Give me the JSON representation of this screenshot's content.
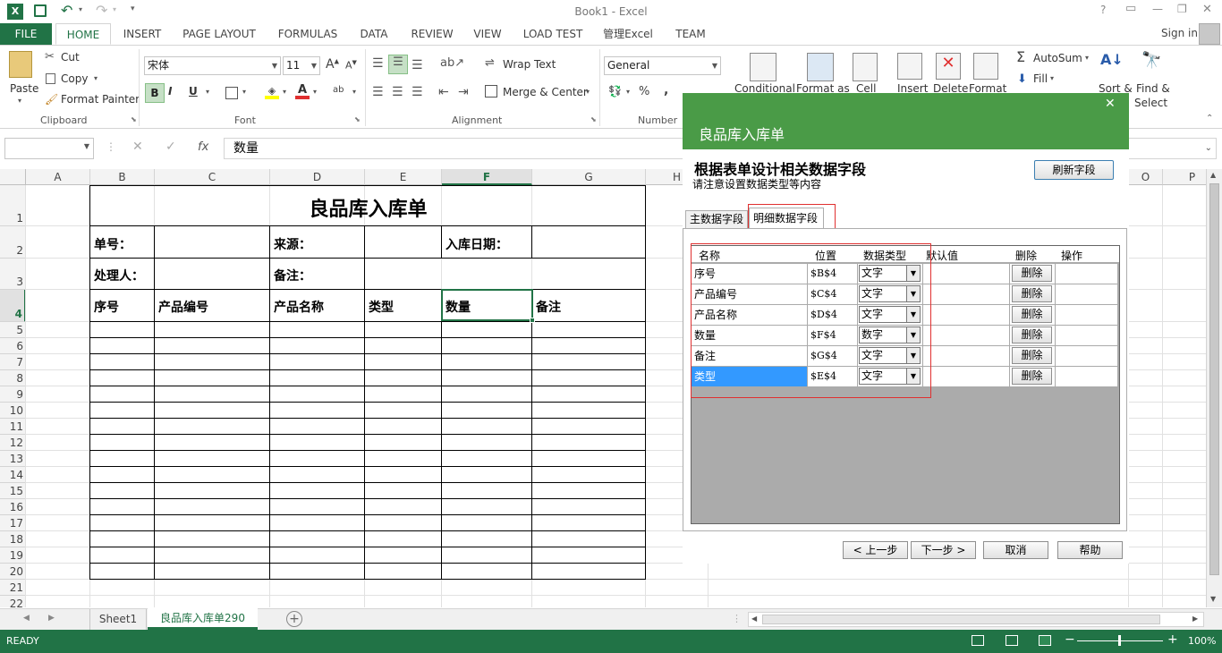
{
  "window": {
    "title": "Book1 - Excel",
    "help": "?",
    "restore_ribbon": "▭",
    "minimize": "—",
    "maximize": "❐",
    "close": "✕"
  },
  "ribbon_tabs": [
    "FILE",
    "HOME",
    "INSERT",
    "PAGE LAYOUT",
    "FORMULAS",
    "DATA",
    "REVIEW",
    "VIEW",
    "LOAD TEST",
    "管理Excel",
    "TEAM"
  ],
  "user": {
    "sign_in": "Sign in"
  },
  "clipboard": {
    "paste": "Paste",
    "cut": "Cut",
    "copy": "Copy",
    "format_painter": "Format Painter",
    "label": "Clipboard"
  },
  "font": {
    "name": "宋体",
    "size": "11",
    "bold": "B",
    "italic": "I",
    "underline": "U",
    "label": "Font"
  },
  "alignment": {
    "wrap_text": "Wrap Text",
    "merge_center": "Merge & Center",
    "label": "Alignment"
  },
  "number": {
    "format": "General",
    "label": "Number"
  },
  "styles": {
    "conditional": "Conditional",
    "format_as": "Format as",
    "cell": "Cell"
  },
  "cells": {
    "insert": "Insert",
    "delete": "Delete",
    "format": "Format"
  },
  "editing": {
    "autosum": "AutoSum",
    "fill": "Fill",
    "sort": "Sort &",
    "find": "Find &",
    "select": "Select"
  },
  "formula_bar": {
    "name_box": "",
    "fx": "fx",
    "value": "数量"
  },
  "columns": [
    "A",
    "B",
    "C",
    "D",
    "E",
    "F",
    "G",
    "H",
    "P"
  ],
  "rows": [
    "1",
    "2",
    "3",
    "4",
    "5",
    "6",
    "7",
    "8",
    "9",
    "10",
    "11",
    "12",
    "13",
    "14",
    "15",
    "16",
    "17",
    "18",
    "19",
    "20",
    "21",
    "22"
  ],
  "sheet": {
    "title": "良品库入库单",
    "r2": {
      "b": "单号：",
      "d": "来源：",
      "f": "入库日期："
    },
    "r3": {
      "b": "处理人：",
      "d": "备注："
    },
    "r4": {
      "b": "序号",
      "c": "产品编号",
      "d": "产品名称",
      "e": "类型",
      "f": "数量",
      "g": "备注"
    }
  },
  "sheet_tabs": {
    "tab1": "Sheet1",
    "tab2": "良品库入库单290",
    "add": "+"
  },
  "status": {
    "ready": "READY",
    "zoom": "100%"
  },
  "dialog": {
    "title": "良品库入库单",
    "close": "✕",
    "heading": "根据表单设计相关数据字段",
    "subheading": "请注意设置数据类型等内容",
    "refresh": "刷新字段",
    "tab_main": "主数据字段",
    "tab_detail": "明细数据字段",
    "headers": [
      "名称",
      "位置",
      "数据类型",
      "默认值",
      "删除",
      "操作"
    ],
    "rows": [
      {
        "name": "序号",
        "pos": "$B$4",
        "type": "文字",
        "del": "删除"
      },
      {
        "name": "产品编号",
        "pos": "$C$4",
        "type": "文字",
        "del": "删除"
      },
      {
        "name": "产品名称",
        "pos": "$D$4",
        "type": "文字",
        "del": "删除"
      },
      {
        "name": "数量",
        "pos": "$F$4",
        "type": "数字",
        "del": "删除"
      },
      {
        "name": "备注",
        "pos": "$G$4",
        "type": "文字",
        "del": "删除"
      },
      {
        "name": "类型",
        "pos": "$E$4",
        "type": "文字",
        "del": "删除"
      }
    ],
    "prev": "< 上一步",
    "next": "下一步 >",
    "cancel": "取消",
    "help": "帮助"
  },
  "colors": {
    "excel_green": "#217346",
    "dialog_green": "#4a9b47",
    "selection_blue": "#3399ff",
    "highlight_red": "#e03030"
  }
}
